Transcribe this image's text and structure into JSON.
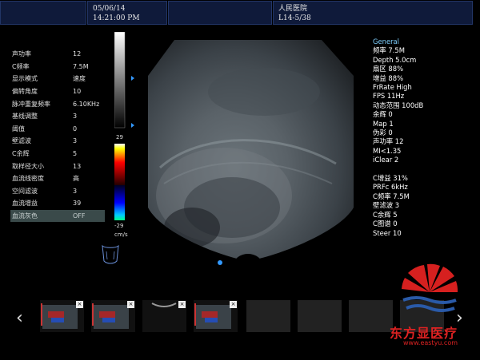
{
  "header": {
    "date": "05/06/14",
    "time": "14:21:00 PM",
    "hospital": "人民医院",
    "probe": "L14-5/38"
  },
  "left_params": [
    {
      "label": "声功率",
      "value": "12"
    },
    {
      "label": "C频率",
      "value": "7.5M"
    },
    {
      "label": "显示模式",
      "value": "速度"
    },
    {
      "label": "偏转角度",
      "value": "10"
    },
    {
      "label": "脉冲重复频率",
      "value": "6.10KHz"
    },
    {
      "label": "基线调整",
      "value": "3"
    },
    {
      "label": "阈值",
      "value": "0"
    },
    {
      "label": "壁滤波",
      "value": "3"
    },
    {
      "label": "C余辉",
      "value": "5"
    },
    {
      "label": "取样径大小",
      "value": "13"
    },
    {
      "label": "血流线密度",
      "value": "高"
    },
    {
      "label": "空间滤波",
      "value": "3"
    },
    {
      "label": "血流增益",
      "value": "39"
    },
    {
      "label": "血流灰色",
      "value": "OFF"
    }
  ],
  "scale": {
    "top": "29",
    "bottom": "-29",
    "unit": "cm/s"
  },
  "right_params": {
    "general_title": "General",
    "general": [
      "频率 7.5M",
      "Depth 5.0cm",
      "扇区 88%",
      "增益 88%",
      "FrRate High",
      "FPS 11Hz",
      "动态范围 100dB",
      "余辉 0",
      "Map 1",
      "伪彩 0",
      "声功率 12",
      "MI<1.35",
      "iClear 2"
    ],
    "color": [
      "C增益 31%",
      "PRFc 6kHz",
      "C频率 7.5M",
      "壁滤波 3",
      "C余辉 5",
      "C图谱 0",
      "Steer 10"
    ]
  },
  "thumbnails": [
    {
      "kind": "color",
      "has_close": true
    },
    {
      "kind": "color",
      "has_close": true
    },
    {
      "kind": "gray",
      "has_close": true
    },
    {
      "kind": "color",
      "has_close": true
    },
    {
      "kind": "empty",
      "has_close": false
    },
    {
      "kind": "empty",
      "has_close": false
    },
    {
      "kind": "empty",
      "has_close": false
    },
    {
      "kind": "empty",
      "has_close": false
    }
  ],
  "nav": {
    "prev": "‹",
    "next": "›"
  },
  "watermark": {
    "text": "东方显医疗",
    "url": "www.eastyu.com"
  },
  "icons": {
    "probe": "probe-mark-icon",
    "body": "body-mark-icon",
    "logo": "logo-icon"
  }
}
